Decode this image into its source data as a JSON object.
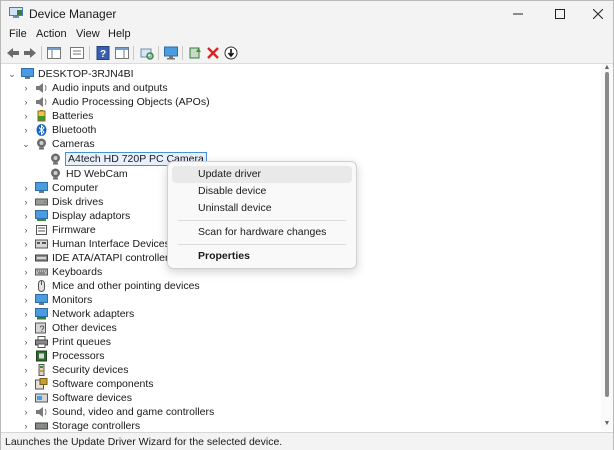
{
  "window": {
    "title": "Device Manager"
  },
  "menu": [
    "File",
    "Action",
    "View",
    "Help"
  ],
  "toolbar_icons": [
    "back-icon",
    "forward-icon",
    "show-hide-console-tree-icon",
    "properties-icon",
    "help-icon",
    "action-pane-icon",
    "scan-hardware-icon",
    "computer-monitor-icon",
    "update-driver-icon",
    "uninstall-device-icon",
    "disable-device-icon"
  ],
  "tree": {
    "root": "DESKTOP-3RJN4BI",
    "nodes": [
      {
        "label": "Audio inputs and outputs",
        "icon": "speaker-icon",
        "expanded": false
      },
      {
        "label": "Audio Processing Objects (APOs)",
        "icon": "speaker-icon",
        "expanded": false
      },
      {
        "label": "Batteries",
        "icon": "battery-icon",
        "expanded": false
      },
      {
        "label": "Bluetooth",
        "icon": "bluetooth-icon",
        "expanded": false
      },
      {
        "label": "Cameras",
        "icon": "camera-icon",
        "expanded": true
      },
      {
        "label": "A4tech HD 720P PC Camera",
        "icon": "camera-icon",
        "child": true,
        "selected": true
      },
      {
        "label": "HD WebCam",
        "icon": "camera-icon",
        "child": true
      },
      {
        "label": "Computer",
        "icon": "monitor-icon",
        "expanded": false
      },
      {
        "label": "Disk drives",
        "icon": "disk-icon",
        "expanded": false
      },
      {
        "label": "Display adaptors",
        "icon": "display-adapter-icon",
        "expanded": false
      },
      {
        "label": "Firmware",
        "icon": "firmware-icon",
        "expanded": false
      },
      {
        "label": "Human Interface Devices",
        "icon": "hid-icon",
        "expanded": false
      },
      {
        "label": "IDE ATA/ATAPI controllers",
        "icon": "ide-icon",
        "expanded": false
      },
      {
        "label": "Keyboards",
        "icon": "keyboard-icon",
        "expanded": false
      },
      {
        "label": "Mice and other pointing devices",
        "icon": "mouse-icon",
        "expanded": false
      },
      {
        "label": "Monitors",
        "icon": "monitor-icon",
        "expanded": false
      },
      {
        "label": "Network adapters",
        "icon": "network-icon",
        "expanded": false
      },
      {
        "label": "Other devices",
        "icon": "other-devices-icon",
        "expanded": false
      },
      {
        "label": "Print queues",
        "icon": "printer-icon",
        "expanded": false
      },
      {
        "label": "Processors",
        "icon": "processor-icon",
        "expanded": false
      },
      {
        "label": "Security devices",
        "icon": "security-icon",
        "expanded": false
      },
      {
        "label": "Software components",
        "icon": "software-component-icon",
        "expanded": false
      },
      {
        "label": "Software devices",
        "icon": "software-device-icon",
        "expanded": false
      },
      {
        "label": "Sound, video and game controllers",
        "icon": "sound-icon",
        "expanded": false
      },
      {
        "label": "Storage controllers",
        "icon": "storage-icon",
        "expanded": false
      }
    ]
  },
  "context_menu": {
    "update_driver": "Update driver",
    "disable_device": "Disable device",
    "uninstall_device": "Uninstall device",
    "scan": "Scan for hardware changes",
    "properties": "Properties"
  },
  "status": "Launches the Update Driver Wizard for the selected device.",
  "colors": {
    "accent": "#0067c0",
    "selection_outline": "#4a90d9",
    "chrome": "#f3f3f3"
  }
}
